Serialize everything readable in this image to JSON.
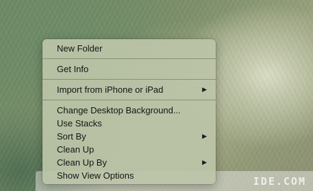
{
  "watermark": "IDE.COM",
  "menu": {
    "items": [
      {
        "label": "New Folder",
        "submenu": false
      },
      {
        "label": "Get Info",
        "submenu": false
      },
      {
        "label": "Import from iPhone or iPad",
        "submenu": true
      },
      {
        "label": "Change Desktop Background...",
        "submenu": false
      },
      {
        "label": "Use Stacks",
        "submenu": false
      },
      {
        "label": "Sort By",
        "submenu": true
      },
      {
        "label": "Clean Up",
        "submenu": false
      },
      {
        "label": "Clean Up By",
        "submenu": true
      },
      {
        "label": "Show View Options",
        "submenu": false
      }
    ],
    "submenu_arrow": "▶"
  }
}
